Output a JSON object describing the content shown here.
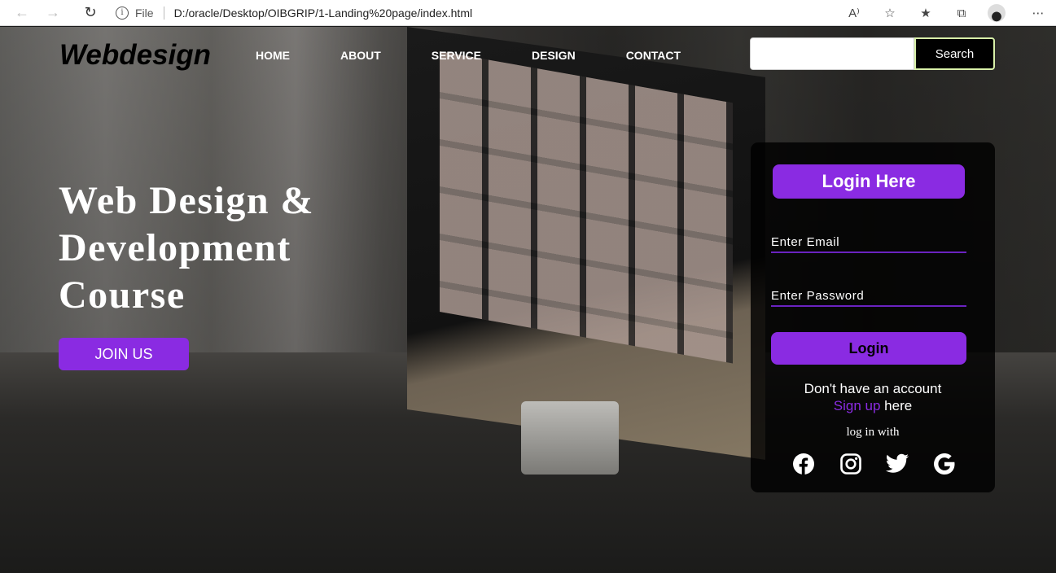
{
  "browser": {
    "file_label": "File",
    "url": "D:/oracle/Desktop/OIBGRIP/1-Landing%20page/index.html"
  },
  "nav": {
    "logo": "Webdesign",
    "items": [
      "HOME",
      "ABOUT",
      "SERVICE",
      "DESIGN",
      "CONTACT"
    ],
    "search_placeholder": "",
    "search_button": "Search"
  },
  "hero": {
    "title": "Web Design & Development Course",
    "join_button": "JOIN US"
  },
  "login": {
    "title": "Login Here",
    "email_placeholder": "Enter Email",
    "password_placeholder": "Enter Password",
    "login_button": "Login",
    "signup_prompt": "Don't have an account",
    "signup_link": "Sign up",
    "signup_suffix": " here",
    "login_with": "log in with",
    "social": [
      "facebook-icon",
      "instagram-icon",
      "twitter-icon",
      "google-icon"
    ]
  },
  "colors": {
    "accent": "#8a2be2",
    "panel_bg": "#000000",
    "search_border": "#d8f0a8"
  }
}
